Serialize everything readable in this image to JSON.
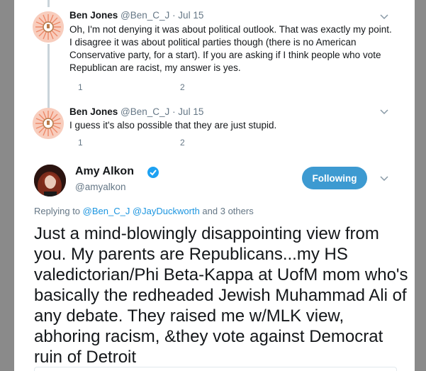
{
  "tweets": [
    {
      "name": "Ben Jones",
      "handle": "@Ben_C_J",
      "date": "· Jul 15",
      "text": "Oh, I'm not denying it was about political outlook. That was exactly my point. I disagree it was about political parties though (there is no American Conservative party, for a start). If you are asking if I think people who vote Republican are racist, my answer is yes.",
      "replies": "1",
      "retweets": "",
      "likes": "2"
    },
    {
      "name": "Ben Jones",
      "handle": "@Ben_C_J",
      "date": "· Jul 15",
      "text": "I guess it's also possible that they are just stupid.",
      "replies": "1",
      "retweets": "",
      "likes": "2"
    }
  ],
  "main": {
    "name": "Amy Alkon",
    "handle": "@amyalkon",
    "follow_label": "Following",
    "replying_prefix": "Replying to",
    "replying_users": "@Ben_C_J @JayDuckworth",
    "replying_suffix": "and 3 others",
    "text": "Just a mind-blowingly disappointing  view from you. My parents are Republicans...my HS valedictorian/Phi Beta-Kappa at UofM mom who's basically the redheaded Jewish Muhammad Ali of any debate. They raised me w/MLK view, abhoring racism, &they vote against Democrat ruin of Detroit"
  },
  "colors": {
    "accent": "#3d9ad1",
    "link": "#1b95e0",
    "muted": "#657786",
    "overlay": "#8a8a8a"
  }
}
